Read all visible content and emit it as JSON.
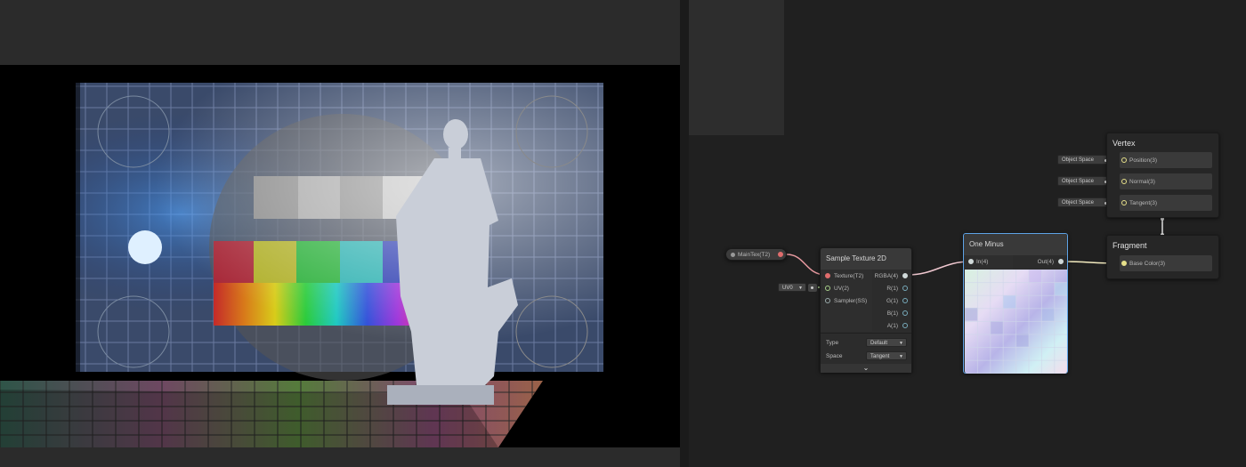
{
  "viewport": {
    "description_icons": {
      "statue": "statue-figure",
      "backdrop": "test-card-pattern"
    }
  },
  "blackboard": {},
  "nodes": {
    "maintex": {
      "label": "MainTex(T2)"
    },
    "uv": {
      "value": "UV0"
    },
    "sample_texture": {
      "title": "Sample Texture 2D",
      "inputs": [
        "Texture(T2)",
        "UV(2)",
        "Sampler(SS)"
      ],
      "outputs": [
        "RGBA(4)",
        "R(1)",
        "G(1)",
        "B(1)",
        "A(1)"
      ],
      "type_label": "Type",
      "type_value": "Default",
      "space_label": "Space",
      "space_value": "Tangent"
    },
    "one_minus": {
      "title": "One Minus",
      "input": "In(4)",
      "output": "Out(4)"
    },
    "vertex": {
      "title": "Vertex",
      "slots": [
        "Position(3)",
        "Normal(3)",
        "Tangent(3)"
      ],
      "space_values": [
        "Object Space",
        "Object Space",
        "Object Space"
      ]
    },
    "fragment": {
      "title": "Fragment",
      "slots": [
        "Base Color(3)"
      ]
    }
  },
  "colors": {
    "edge_texture": "#e89aa0",
    "edge_rgba": "#f0c8d0",
    "edge_out": "#f4ecc0",
    "edge_uv": "#a8d08a",
    "selected_border": "#5ea3e6"
  }
}
